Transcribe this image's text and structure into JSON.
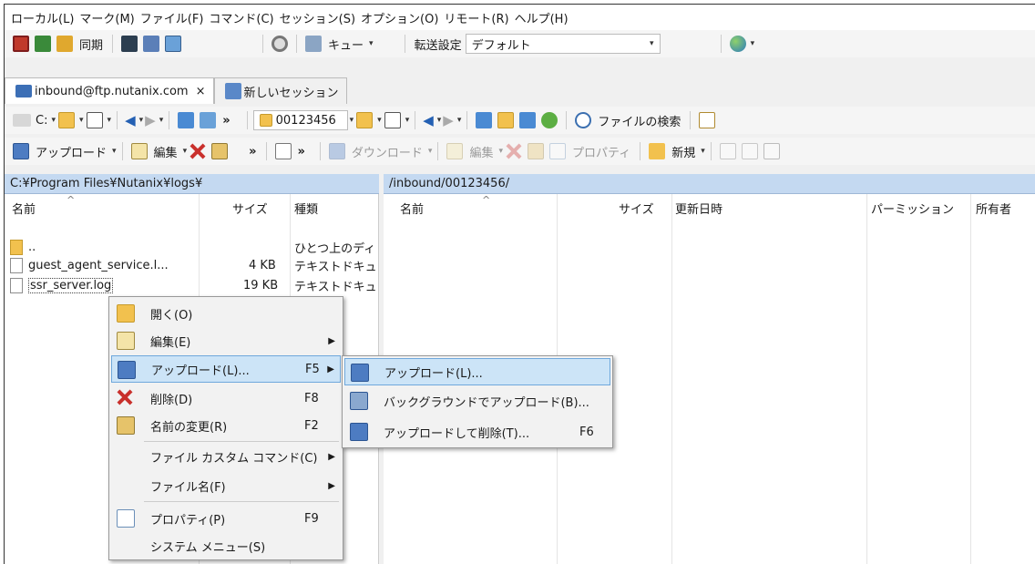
{
  "menubar": [
    "ローカル(L)",
    "マーク(M)",
    "ファイル(F)",
    "コマンド(C)",
    "セッション(S)",
    "オプション(O)",
    "リモート(R)",
    "ヘルプ(H)"
  ],
  "toolbar1": {
    "sync_label": "同期",
    "queue_label": "キュー",
    "transfer_label": "転送設定",
    "transfer_value": "デフォルト"
  },
  "tabs": {
    "session": "inbound@ftp.nutanix.com",
    "close": "×",
    "new_session": "新しいセッション"
  },
  "local_nav": {
    "drive": "C:",
    "more": "»"
  },
  "remote_nav": {
    "folder": "00123456",
    "find_files": "ファイルの検索"
  },
  "local_actions": {
    "upload": "アップロード",
    "edit": "編集",
    "more": "»"
  },
  "remote_actions": {
    "download": "ダウンロード",
    "edit": "編集",
    "properties": "プロパティ",
    "new": "新規"
  },
  "local_pane": {
    "path": "C:¥Program Files¥Nutanix¥logs¥",
    "columns": {
      "name": "名前",
      "size": "サイズ",
      "type": "種類"
    },
    "rows": [
      {
        "name": "..",
        "size": "",
        "type": "ひとつ上のディ"
      },
      {
        "name": "guest_agent_service.l...",
        "size": "4 KB",
        "type": "テキストドキュ"
      },
      {
        "name": "ssr_server.log",
        "size": "19 KB",
        "type": "テキストドキュ"
      }
    ]
  },
  "remote_pane": {
    "path": "/inbound/00123456/",
    "columns": {
      "name": "名前",
      "size": "サイズ",
      "modified": "更新日時",
      "permissions": "パーミッション",
      "owner": "所有者"
    }
  },
  "context_menu": [
    {
      "label": "開く(O)",
      "key": "",
      "submenu": false
    },
    {
      "label": "編集(E)",
      "key": "",
      "submenu": true
    },
    {
      "label": "アップロード(L)...",
      "key": "F5",
      "submenu": true
    },
    {
      "label": "削除(D)",
      "key": "F8",
      "submenu": false
    },
    {
      "label": "名前の変更(R)",
      "key": "F2",
      "submenu": false
    },
    {
      "label": "ファイル カスタム コマンド(C)",
      "key": "",
      "submenu": true
    },
    {
      "label": "ファイル名(F)",
      "key": "",
      "submenu": true
    },
    {
      "label": "プロパティ(P)",
      "key": "F9",
      "submenu": false
    },
    {
      "label": "システム メニュー(S)",
      "key": "",
      "submenu": false
    }
  ],
  "submenu": [
    {
      "label": "アップロード(L)...",
      "key": ""
    },
    {
      "label": "バックグラウンドでアップロード(B)...",
      "key": ""
    },
    {
      "label": "アップロードして削除(T)...",
      "key": "F6"
    }
  ],
  "glyphs": {
    "caret": "▾",
    "submenu_arrow": "▶",
    "back": "◀",
    "fwd": "▶",
    "up_arrow": "^"
  }
}
